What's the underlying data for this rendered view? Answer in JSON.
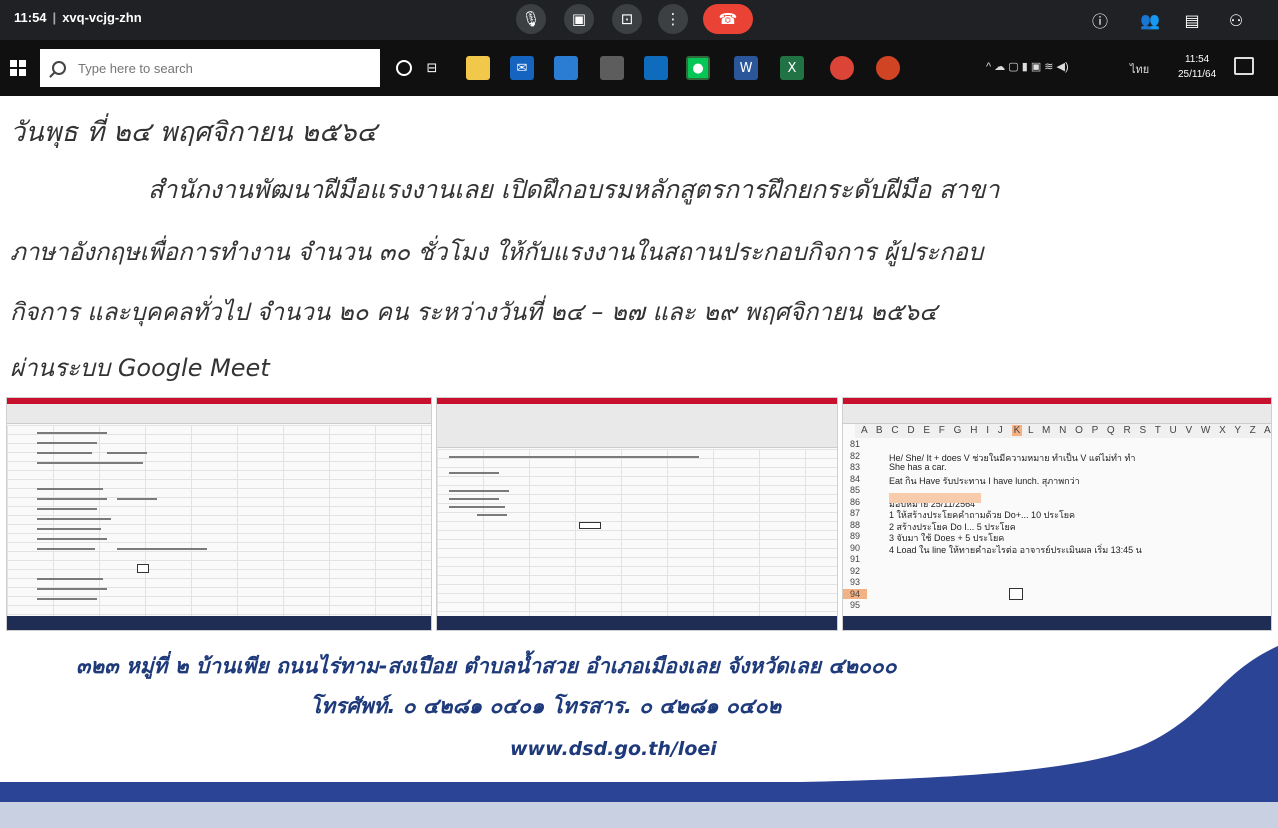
{
  "meet": {
    "time": "11:54",
    "meeting_code": "xvq-vcjg-zhn"
  },
  "taskbar": {
    "search_placeholder": "Type here to search",
    "clock_time": "11:54",
    "clock_date": "25/11/64",
    "lang_indicator": "ไทย"
  },
  "announcement": {
    "date_line": "วันพุธ ที่  ๒๔ พฤศจิกายน ๒๕๖๔",
    "line1": "สำนักงานพัฒนาฝีมือแรงงานเลย เปิดฝึกอบรมหลักสูตรการฝึกยกระดับฝีมือ สาขา",
    "line2": "ภาษาอังกฤษเพื่อการทำงาน จำนวน ๓๐ ชั่วโมง ให้กับแรงงานในสถานประกอบกิจการ ผู้ประกอบ",
    "line3": "กิจการ และบุคคลทั่วไป จำนวน ๒๐ คน ระหว่างวันที่  ๒๔ – ๒๗ และ ๒๙ พฤศจิกายน ๒๕๖๔",
    "line4": "ผ่านระบบ Google Meet"
  },
  "screenshot3": {
    "columns": "A B C D E F G H I J",
    "k_col": "K",
    "columns_rest": "L M N O P Q R S T U V W X Y Z AA",
    "rows": [
      {
        "num": "81",
        "text": ""
      },
      {
        "num": "82",
        "text": "He/ She/ It + does    V ช่วยในมีความหมาย ทำเป็น V แต่ไม่ทำ ทำ"
      },
      {
        "num": "83",
        "text": "She has a car."
      },
      {
        "num": "84",
        "text": "Eat    กิน    Have      รับประทาน        I have lunch.     สุภาพกว่า"
      },
      {
        "num": "85",
        "text": ""
      },
      {
        "num": "86",
        "text": "มอบหมาย 25/11/2564"
      },
      {
        "num": "87",
        "text": "1 ให้สร้างประโยคคำถามด้วย Do+... 10 ประโยค"
      },
      {
        "num": "88",
        "text": "2 สร้างประโยค Do I... 5 ประโยค"
      },
      {
        "num": "89",
        "text": "3 จับมา ใช้ Does + 5 ประโยค"
      },
      {
        "num": "90",
        "text": "4 Load ใน line     ให้ทายคำอะไรต่อ อาจารย์ประเมินผล เริ่ม 13:45 น"
      },
      {
        "num": "91",
        "text": ""
      },
      {
        "num": "92",
        "text": ""
      },
      {
        "num": "93",
        "text": ""
      },
      {
        "num": "94",
        "text": ""
      },
      {
        "num": "95",
        "text": ""
      }
    ]
  },
  "footer": {
    "address": "๓๒๓ หมู่ที่ ๒ บ้านเพีย ถนนไร่ทาม-สงเปือย ตำบลน้ำสวย อำเภอเมืองเลย จังหวัดเลย ๔๒๐๐๐",
    "phone": "โทรศัพท์. ๐ ๔๒๘๑ ๐๔๐๑ โทรสาร. ๐ ๔๒๘๑ ๐๔๐๒",
    "website": "www.dsd.go.th/loei"
  },
  "colors": {
    "meet_bar": "#202124",
    "hangup": "#ea4335",
    "banner_blue": "#2b4496",
    "footer_text": "#1e3a7b",
    "highlight": "#f8cbad"
  }
}
